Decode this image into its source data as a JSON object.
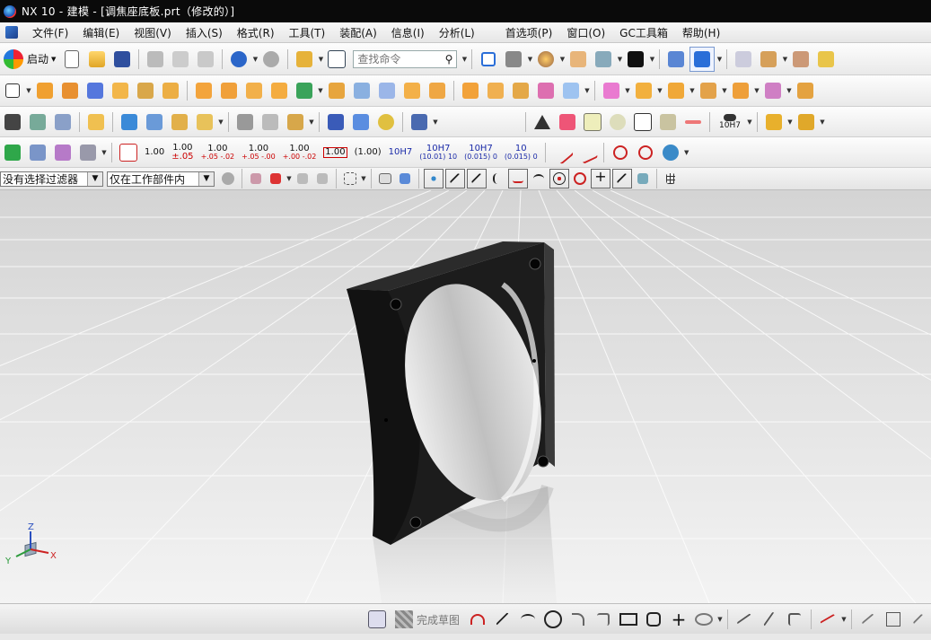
{
  "window": {
    "title": "NX 10 - 建模 - [调焦座底板.prt（修改的）]"
  },
  "menu": {
    "items": [
      "文件(F)",
      "编辑(E)",
      "视图(V)",
      "插入(S)",
      "格式(R)",
      "工具(T)",
      "装配(A)",
      "信息(I)",
      "分析(L)",
      "首选项(P)",
      "窗口(O)",
      "GC工具箱",
      "帮助(H)"
    ]
  },
  "toolbar": {
    "start_label": "启动",
    "search_placeholder": "查找命令"
  },
  "pmi_toolbar": {
    "labels": [
      {
        "main": "1.00",
        "tol": ""
      },
      {
        "main": "1.00",
        "tol": "±.05"
      },
      {
        "main": "1.00",
        "tol": "+.05 -.02"
      },
      {
        "main": "1.00",
        "tol": "+.05 -.00"
      },
      {
        "main": "1.00",
        "tol": "+.00 -.02"
      },
      {
        "main": "1.00",
        "tol": ""
      },
      {
        "main": "(1.00)",
        "tol": ""
      },
      {
        "main": "10H7",
        "tol": ""
      },
      {
        "main": "10H7",
        "tol": "(10.01) 10"
      },
      {
        "main": "10H7",
        "tol": "(0.015) 0"
      },
      {
        "main": "10",
        "tol": "(0.015) 0"
      }
    ],
    "fit_label": "10H7"
  },
  "filterbar": {
    "type_filter": "没有选择过滤器",
    "scope_filter": "仅在工作部件内"
  },
  "viewport": {
    "triad": {
      "x": "X",
      "y": "Y",
      "z": "Z"
    }
  },
  "bottom": {
    "finish_sketch_label": "完成草图"
  },
  "colors": {
    "titlebar": "#0a0a0a",
    "part_fill": "#1c1c1c",
    "viewport_bg": "#e6e6e6"
  }
}
